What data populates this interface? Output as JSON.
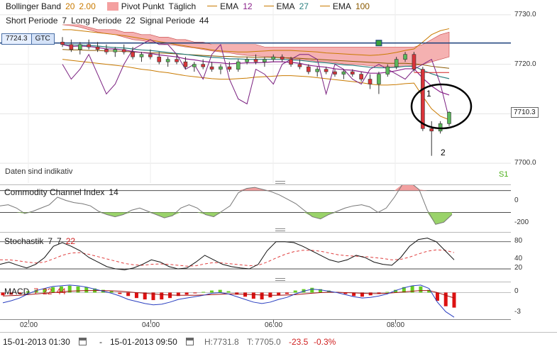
{
  "chart_data": [
    {
      "type": "candlestick",
      "title": "",
      "ylim": [
        7696,
        7733
      ],
      "y_ticks": [
        "7730.0",
        "7720.0",
        "7710.0",
        "7700.0"
      ],
      "y_tick_values": [
        7730,
        7720,
        7710,
        7700
      ],
      "x_ticks": [
        "02:00",
        "04:00",
        "06:00",
        "08:00"
      ],
      "legend": [
        {
          "name": "Bollinger Band",
          "params": [
            "20",
            "2.00"
          ],
          "param_colors": [
            "#c97a00",
            "#c97a00"
          ]
        },
        {
          "name": "Pivot Punkt",
          "params": [
            "Täglich"
          ],
          "param_colors": [
            "#1a1a1a"
          ]
        },
        {
          "name": "EMA",
          "params": [
            "12"
          ],
          "param_colors": [
            "#8a1f8a"
          ]
        },
        {
          "name": "EMA",
          "params": [
            "27"
          ],
          "param_colors": [
            "#2a7f7f"
          ]
        },
        {
          "name": "EMA",
          "params": [
            "100"
          ],
          "param_colors": [
            "#8a5a00"
          ]
        }
      ],
      "legend2": [
        {
          "name": "Short Periode",
          "value": "7"
        },
        {
          "name": "Long Periode",
          "value": "22"
        },
        {
          "name": "Signal Periode",
          "value": "44"
        }
      ],
      "order_line": {
        "price": 7724.3,
        "label": "7724.3",
        "tag": "GTC"
      },
      "last_price": {
        "value": 7710.3,
        "label": "7710.3"
      },
      "note": "Daten sind indikativ",
      "pivot_label": "S1",
      "annotations": [
        "1",
        "2"
      ],
      "candles": [
        {
          "o": 7724.5,
          "h": 7725.5,
          "l": 7723.5,
          "c": 7724.0
        },
        {
          "o": 7724.0,
          "h": 7725.0,
          "l": 7722.5,
          "c": 7723.0
        },
        {
          "o": 7723.0,
          "h": 7724.5,
          "l": 7722.0,
          "c": 7724.0
        },
        {
          "o": 7724.0,
          "h": 7725.0,
          "l": 7723.0,
          "c": 7723.5
        },
        {
          "o": 7723.5,
          "h": 7724.5,
          "l": 7722.5,
          "c": 7723.0
        },
        {
          "o": 7723.0,
          "h": 7724.0,
          "l": 7722.0,
          "c": 7722.5
        },
        {
          "o": 7722.5,
          "h": 7723.5,
          "l": 7721.5,
          "c": 7723.0
        },
        {
          "o": 7723.0,
          "h": 7724.0,
          "l": 7722.0,
          "c": 7722.5
        },
        {
          "o": 7722.5,
          "h": 7723.5,
          "l": 7721.0,
          "c": 7721.5
        },
        {
          "o": 7721.5,
          "h": 7722.5,
          "l": 7720.5,
          "c": 7722.0
        },
        {
          "o": 7722.0,
          "h": 7723.0,
          "l": 7721.0,
          "c": 7721.5
        },
        {
          "o": 7721.5,
          "h": 7722.5,
          "l": 7720.0,
          "c": 7720.5
        },
        {
          "o": 7720.5,
          "h": 7721.5,
          "l": 7719.5,
          "c": 7721.0
        },
        {
          "o": 7721.0,
          "h": 7722.0,
          "l": 7720.0,
          "c": 7720.5
        },
        {
          "o": 7720.5,
          "h": 7721.5,
          "l": 7719.0,
          "c": 7719.5
        },
        {
          "o": 7719.5,
          "h": 7720.5,
          "l": 7718.5,
          "c": 7720.0
        },
        {
          "o": 7720.0,
          "h": 7721.0,
          "l": 7719.0,
          "c": 7719.5
        },
        {
          "o": 7719.5,
          "h": 7720.5,
          "l": 7718.5,
          "c": 7719.0
        },
        {
          "o": 7719.0,
          "h": 7720.0,
          "l": 7718.0,
          "c": 7719.5
        },
        {
          "o": 7719.5,
          "h": 7720.5,
          "l": 7718.5,
          "c": 7719.0
        },
        {
          "o": 7719.0,
          "h": 7721.0,
          "l": 7718.5,
          "c": 7720.5
        },
        {
          "o": 7720.5,
          "h": 7721.5,
          "l": 7720.0,
          "c": 7721.0
        },
        {
          "o": 7721.0,
          "h": 7722.0,
          "l": 7720.0,
          "c": 7720.5
        },
        {
          "o": 7720.5,
          "h": 7721.5,
          "l": 7719.5,
          "c": 7721.0
        },
        {
          "o": 7721.0,
          "h": 7722.0,
          "l": 7720.5,
          "c": 7721.5
        },
        {
          "o": 7721.5,
          "h": 7722.0,
          "l": 7720.5,
          "c": 7721.0
        },
        {
          "o": 7721.0,
          "h": 7721.5,
          "l": 7719.5,
          "c": 7720.0
        },
        {
          "o": 7720.0,
          "h": 7721.0,
          "l": 7719.0,
          "c": 7719.5
        },
        {
          "o": 7719.5,
          "h": 7720.0,
          "l": 7718.0,
          "c": 7718.5
        },
        {
          "o": 7718.5,
          "h": 7719.5,
          "l": 7717.5,
          "c": 7719.0
        },
        {
          "o": 7719.0,
          "h": 7719.5,
          "l": 7718.0,
          "c": 7718.5
        },
        {
          "o": 7718.5,
          "h": 7719.0,
          "l": 7717.5,
          "c": 7718.0
        },
        {
          "o": 7718.0,
          "h": 7719.0,
          "l": 7717.0,
          "c": 7718.5
        },
        {
          "o": 7718.5,
          "h": 7719.0,
          "l": 7717.5,
          "c": 7718.0
        },
        {
          "o": 7718.0,
          "h": 7718.5,
          "l": 7716.5,
          "c": 7717.0
        },
        {
          "o": 7717.0,
          "h": 7718.0,
          "l": 7715.0,
          "c": 7716.0
        },
        {
          "o": 7716.0,
          "h": 7718.5,
          "l": 7714.0,
          "c": 7718.0
        },
        {
          "o": 7718.0,
          "h": 7720.0,
          "l": 7717.5,
          "c": 7719.5
        },
        {
          "o": 7719.5,
          "h": 7721.5,
          "l": 7719.0,
          "c": 7721.0
        },
        {
          "o": 7721.0,
          "h": 7722.5,
          "l": 7720.5,
          "c": 7722.0
        },
        {
          "o": 7722.0,
          "h": 7722.5,
          "l": 7718.5,
          "c": 7719.0
        },
        {
          "o": 7719.0,
          "h": 7719.5,
          "l": 7706.5,
          "c": 7707.0
        },
        {
          "o": 7707.0,
          "h": 7708.5,
          "l": 7701.5,
          "c": 7706.5
        },
        {
          "o": 7706.5,
          "h": 7708.5,
          "l": 7706.0,
          "c": 7708.0
        },
        {
          "o": 7708.0,
          "h": 7710.5,
          "l": 7707.5,
          "c": 7710.3
        }
      ],
      "ema_12": [
        7724,
        7723.6,
        7723.7,
        7723.6,
        7723.4,
        7723.1,
        7723.1,
        7722.9,
        7722.6,
        7722.4,
        7722.2,
        7721.9,
        7721.7,
        7721.5,
        7721.1,
        7720.9,
        7720.6,
        7720.4,
        7720.3,
        7720.1,
        7720.2,
        7720.3,
        7720.3,
        7720.4,
        7720.5,
        7720.5,
        7720.4,
        7720.2,
        7719.8,
        7719.6,
        7719.4,
        7719.1,
        7718.9,
        7718.8,
        7718.5,
        7718.2,
        7718.2,
        7718.4,
        7718.7,
        7719.1,
        7719.1,
        7717.2,
        7715.6,
        7714.4,
        7713.8
      ],
      "ema_27": [
        7724,
        7723.9,
        7723.9,
        7723.8,
        7723.7,
        7723.5,
        7723.4,
        7723.3,
        7723.1,
        7722.9,
        7722.8,
        7722.6,
        7722.4,
        7722.2,
        7722,
        7721.8,
        7721.6,
        7721.4,
        7721.3,
        7721.1,
        7721.1,
        7721,
        7721,
        7721,
        7721,
        7721,
        7720.9,
        7720.8,
        7720.6,
        7720.4,
        7720.3,
        7720.1,
        7719.9,
        7719.8,
        7719.6,
        7719.4,
        7719.3,
        7719.3,
        7719.4,
        7719.6,
        7719.6,
        7718.8,
        7718.1,
        7717.5,
        7717.1
      ],
      "ema_100": [
        7723,
        7722.9,
        7722.9,
        7722.8,
        7722.8,
        7722.7,
        7722.7,
        7722.6,
        7722.5,
        7722.4,
        7722.3,
        7722.3,
        7722.2,
        7722.1,
        7722,
        7721.9,
        7721.8,
        7721.7,
        7721.6,
        7721.6,
        7721.5,
        7721.5,
        7721.4,
        7721.4,
        7721.4,
        7721.3,
        7721.3,
        7721.2,
        7721.1,
        7721,
        7720.9,
        7720.8,
        7720.7,
        7720.6,
        7720.5,
        7720.4,
        7720.3,
        7720.2,
        7720.2,
        7720.2,
        7720.1,
        7719.9,
        7719.6,
        7719.4,
        7719.2
      ],
      "bb_upper": [
        7727,
        7727,
        7726.8,
        7726.6,
        7726.4,
        7726.2,
        7726,
        7725.8,
        7725.5,
        7725.2,
        7724.9,
        7724.6,
        7724.3,
        7724,
        7723.7,
        7723.4,
        7723.2,
        7722.9,
        7722.7,
        7722.6,
        7722.5,
        7722.5,
        7722.6,
        7722.7,
        7722.8,
        7722.8,
        7722.8,
        7722.7,
        7722.6,
        7722.5,
        7722.3,
        7722.2,
        7722.1,
        7722,
        7721.9,
        7721.8,
        7721.9,
        7722.1,
        7722.4,
        7722.8,
        7723.1,
        7724.5,
        7726,
        7726.8,
        7727.2
      ],
      "bb_lower": [
        7721,
        7720.8,
        7720.6,
        7720.4,
        7720.2,
        7720,
        7719.8,
        7719.6,
        7719.3,
        7719,
        7718.8,
        7718.5,
        7718.3,
        7718,
        7717.7,
        7717.5,
        7717.3,
        7717.1,
        7717,
        7717.0,
        7717.1,
        7717.2,
        7717.4,
        7717.5,
        7717.6,
        7717.7,
        7717.7,
        7717.6,
        7717.5,
        7717.3,
        7717.1,
        7716.9,
        7716.7,
        7716.5,
        7716.3,
        7716,
        7715.8,
        7715.8,
        7715.9,
        7716.1,
        7716.2,
        7713.5,
        7711,
        7709.5,
        7708.8
      ],
      "cloud_top": [
        7728,
        7728,
        7728,
        7727.5,
        7727,
        7727,
        7727,
        7726.5,
        7726.5,
        7726,
        7726,
        7725.5,
        7725.5,
        7725,
        7725,
        7724.5,
        7724.5,
        7724,
        7724,
        7724,
        7724,
        7724,
        7724,
        7723.5,
        7723.5,
        7723.5,
        7723.5,
        7723.5,
        7723.5,
        7723.5,
        7723.5,
        7723.5,
        7723.5,
        7723.5,
        7723.5,
        7723.5,
        7723.5,
        7723.5,
        7723.5,
        7723.5,
        7723.5,
        7724,
        7725,
        7726,
        7726.5
      ],
      "cloud_bottom": [
        7728,
        7727.8,
        7727.5,
        7727,
        7726.5,
        7726.2,
        7726,
        7725.5,
        7725,
        7724.8,
        7724.5,
        7724.2,
        7724,
        7723.8,
        7723.5,
        7723.3,
        7723,
        7722.7,
        7722.5,
        7722.3,
        7722,
        7721.8,
        7721.7,
        7721.6,
        7721.5,
        7721.3,
        7721.1,
        7721,
        7720.8,
        7720.6,
        7720.5,
        7720.3,
        7720.1,
        7720,
        7719.9,
        7719.7,
        7719.6,
        7719.5,
        7719.5,
        7719.6,
        7719.7,
        7720,
        7720.5,
        7721,
        7721.5
      ],
      "macd_line_price": [
        7720,
        7717,
        7719,
        7722,
        7718,
        7714,
        7716,
        7720,
        7723,
        7724,
        7725,
        7724,
        7724,
        7722,
        7719,
        7720,
        7717,
        7722,
        7724,
        7717,
        7713,
        7712,
        7719,
        7718,
        7716,
        7720,
        7721,
        7722,
        7722,
        7721,
        7714,
        7720,
        7719,
        7717,
        7716,
        7719,
        7720,
        7719,
        7718,
        7717,
        7719,
        7720,
        7721,
        7716,
        7709
      ],
      "pivot": {
        "S1": 7716.5,
        "PP_upper": 7721.5,
        "PP_lower": 7720.5
      }
    },
    {
      "type": "area",
      "title": "Commodity Channel Index",
      "params": [
        "14"
      ],
      "ylim": [
        -260,
        150
      ],
      "y_ticks": [
        "0",
        "-200"
      ],
      "y_tick_values": [
        0,
        -200
      ],
      "levels": [
        100,
        -100
      ],
      "values": [
        -40,
        -30,
        -60,
        -110,
        -90,
        -60,
        -30,
        40,
        10,
        -10,
        -20,
        -40,
        -90,
        -120,
        -140,
        -120,
        -80,
        -60,
        -90,
        -120,
        -150,
        -130,
        -60,
        -30,
        -60,
        -120,
        -140,
        -90,
        -40,
        80,
        120,
        130,
        110,
        90,
        60,
        20,
        -20,
        -80,
        -140,
        -160,
        -120,
        -90,
        -60,
        -40,
        -30,
        -50,
        -100,
        -60,
        40,
        160,
        170,
        110,
        -80,
        -210,
        -190,
        -120
      ]
    },
    {
      "type": "line",
      "title": "Stochastik",
      "params": [
        "7",
        "7",
        "22"
      ],
      "ylim": [
        -5,
        100
      ],
      "y_ticks": [
        "80",
        "40",
        "20"
      ],
      "y_tick_values": [
        80,
        40,
        20
      ],
      "series": [
        {
          "values": [
            30,
            35,
            28,
            22,
            30,
            45,
            70,
            78,
            70,
            60,
            45,
            35,
            25,
            20,
            18,
            22,
            30,
            40,
            35,
            25,
            20,
            22,
            35,
            50,
            40,
            30,
            25,
            22,
            20,
            30,
            60,
            80,
            80,
            78,
            70,
            60,
            50,
            40,
            35,
            40,
            50,
            45,
            35,
            30,
            28,
            45,
            70,
            85,
            88,
            80,
            60,
            40
          ]
        },
        {
          "values": [
            40,
            40,
            38,
            35,
            33,
            35,
            42,
            50,
            55,
            56,
            52,
            47,
            42,
            37,
            32,
            29,
            28,
            30,
            31,
            30,
            28,
            26,
            27,
            31,
            34,
            33,
            31,
            29,
            27,
            28,
            35,
            44,
            52,
            58,
            61,
            61,
            59,
            55,
            51,
            49,
            48,
            47,
            45,
            43,
            40,
            41,
            46,
            53,
            59,
            62,
            61,
            56
          ]
        }
      ]
    },
    {
      "type": "bar",
      "title": "MACD",
      "params": [
        "7",
        "22",
        "44"
      ],
      "ylim": [
        -4,
        1.5
      ],
      "y_ticks": [
        "0",
        "-3"
      ],
      "y_tick_values": [
        0,
        -3
      ],
      "values": [
        -0.4,
        -0.3,
        -0.2,
        0.2,
        0.4,
        0.6,
        0.8,
        0.9,
        1.0,
        0.9,
        0.8,
        0.6,
        0.4,
        0.2,
        -0.2,
        -0.5,
        -0.8,
        -1.0,
        -1.1,
        -1.0,
        -0.8,
        -0.5,
        -0.3,
        -0.1,
        0.1,
        0.3,
        0.4,
        0.2,
        -0.3,
        -0.6,
        -0.9,
        -1.0,
        -0.7,
        -0.4,
        -0.2,
        0.3,
        0.5,
        0.7,
        0.5,
        0.3,
        0.1,
        -0.2,
        -0.5,
        -0.6,
        -0.4,
        -0.2,
        0.1,
        0.4,
        0.8,
        1.0,
        0.9,
        0.4,
        -1.2,
        -2.0,
        -2.2
      ],
      "signal": [
        -0.5,
        -0.45,
        -0.4,
        -0.3,
        -0.2,
        -0.1,
        0.0,
        0.1,
        0.2,
        0.25,
        0.3,
        0.3,
        0.3,
        0.25,
        0.2,
        0.1,
        0.0,
        -0.1,
        -0.2,
        -0.3,
        -0.35,
        -0.4,
        -0.4,
        -0.4,
        -0.35,
        -0.3,
        -0.25,
        -0.2,
        -0.2,
        -0.25,
        -0.3,
        -0.35,
        -0.4,
        -0.4,
        -0.35,
        -0.3,
        -0.2,
        -0.1,
        0.0,
        0.05,
        0.05,
        0.0,
        -0.05,
        -0.1,
        -0.15,
        -0.15,
        -0.1,
        0.0,
        0.1,
        0.2,
        0.3,
        0.3,
        0.0,
        -0.4,
        -0.8
      ],
      "macd": [
        -1.5,
        -1.2,
        -0.8,
        -0.2,
        0.3,
        0.6,
        0.9,
        1.0,
        1.1,
        1.0,
        0.8,
        0.5,
        0.2,
        -0.1,
        -0.5,
        -1.0,
        -1.3,
        -1.6,
        -1.8,
        -1.7,
        -1.4,
        -1.0,
        -0.8,
        -0.6,
        -0.4,
        -0.1,
        0.0,
        -0.2,
        -0.6,
        -1.0,
        -1.4,
        -1.6,
        -1.4,
        -1.0,
        -0.7,
        -0.2,
        0.2,
        0.5,
        0.4,
        0.2,
        0.0,
        -0.3,
        -0.6,
        -0.8,
        -0.7,
        -0.5,
        -0.2,
        0.3,
        0.7,
        1.0,
        1.1,
        0.6,
        -1.4,
        -2.8,
        -3.6
      ]
    }
  ],
  "footer": {
    "from": "15-01-2013 01:30",
    "dash": "-",
    "to": "15-01-2013 09:50",
    "high_label": "H:",
    "high": "7731.8",
    "low_label": "T:",
    "low": "7705.0",
    "change": "-23.5",
    "change_pct": "-0.3%"
  }
}
